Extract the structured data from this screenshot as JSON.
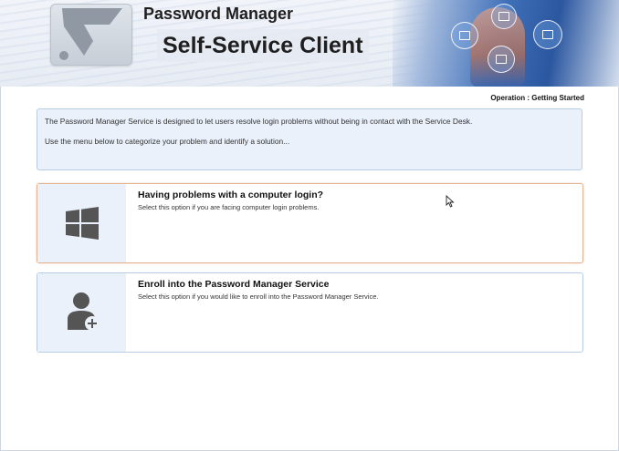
{
  "header": {
    "app_name": "Password Manager",
    "client_title": "Self-Service Client",
    "logo_icon": "password-manager-logo-icon"
  },
  "operation": {
    "text": "Operation : Getting Started"
  },
  "info": {
    "line1": "The Password Manager Service is designed to let users resolve login problems without being in contact with the Service Desk.",
    "line2": "Use the menu below to categorize your problem and identify a solution..."
  },
  "options": [
    {
      "title": "Having problems with a computer login?",
      "description": "Select this option if you are facing computer login problems.",
      "icon": "windows-icon"
    },
    {
      "title": "Enroll into the Password Manager Service",
      "description": "Select this option if you would like to enroll into the Password Manager Service.",
      "icon": "add-user-icon"
    }
  ],
  "colors": {
    "panel_bg": "#eaf1fb",
    "panel_border": "#b7cce6",
    "active_border": "#e2b491",
    "icon_color": "#555555"
  }
}
